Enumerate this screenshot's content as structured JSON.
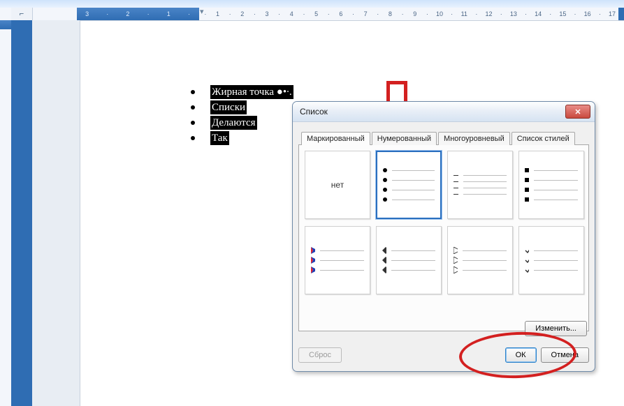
{
  "ruler": {
    "corner": "⌐",
    "neg_nums": [
      "3",
      "·",
      "2",
      "·",
      "1",
      "·"
    ],
    "pos_nums": [
      "·",
      "1",
      "·",
      "2",
      "·",
      "3",
      "·",
      "4",
      "·",
      "5",
      "·",
      "6",
      "·",
      "7",
      "·",
      "8",
      "·",
      "9",
      "·",
      "10",
      "·",
      "11",
      "·",
      "12",
      "·",
      "13",
      "·",
      "14",
      "·",
      "15",
      "·",
      "16",
      "·",
      "17"
    ],
    "indent_marker": "▾"
  },
  "document": {
    "bullets": [
      "Жирная точка ●•∙.",
      "Списки",
      "Делаются",
      "Так"
    ]
  },
  "dialog": {
    "title": "Список",
    "close": "✕",
    "tabs": [
      "Маркированный",
      "Нумерованный",
      "Многоуровневый",
      "Список стилей"
    ],
    "none_label": "нет",
    "modify": "Изменить...",
    "reset": "Сброс",
    "ok": "ОК",
    "cancel": "Отмена"
  }
}
